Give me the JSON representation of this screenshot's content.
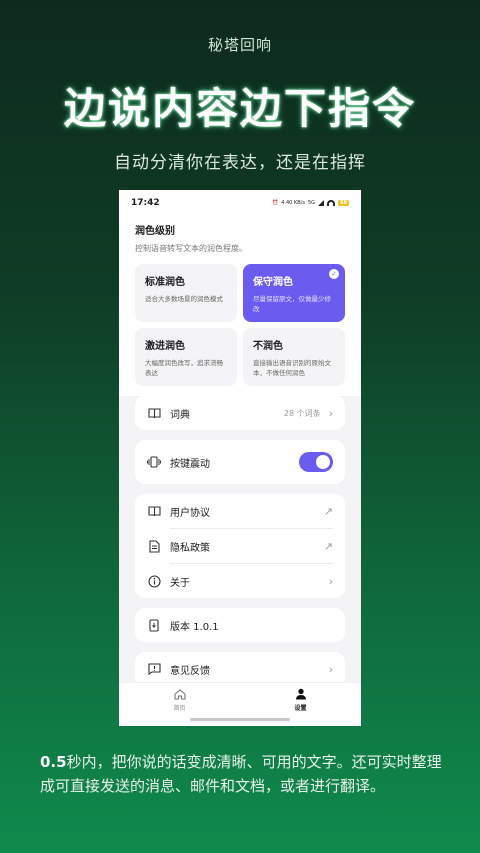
{
  "promo": {
    "brand": "秘塔回响",
    "headline": "边说内容边下指令",
    "subtitle": "自动分清你在表达，还是在指挥",
    "footer_highlight": "0.5",
    "footer_text": "秒内，把你说的话变成清晰、可用的文字。还可实时整理成可直接发送的消息、邮件和文档，或者进行翻译。"
  },
  "status": {
    "time": "17:42",
    "speed": "4.40 KB/s",
    "network": "5G",
    "battery": "69"
  },
  "polish": {
    "title": "润色级别",
    "desc": "控制语音转写文本的润色程度。",
    "options": [
      {
        "title": "标准润色",
        "desc": "适合大多数场景的润色模式"
      },
      {
        "title": "保守润色",
        "desc": "尽量保留原文，仅做最少修改"
      },
      {
        "title": "激进润色",
        "desc": "大幅度润色改写，追求流畅表达"
      },
      {
        "title": "不润色",
        "desc": "直接输出语音识别的原始文本，不做任何润色"
      }
    ]
  },
  "dictionary": {
    "label": "词典",
    "count": "28 个词条"
  },
  "vibration": {
    "label": "按键震动",
    "enabled": true
  },
  "links": [
    {
      "label": "用户协议"
    },
    {
      "label": "隐私政策"
    },
    {
      "label": "关于"
    }
  ],
  "version": {
    "label": "版本 1.0.1"
  },
  "feedback": {
    "label": "意见反馈"
  },
  "tabs": [
    {
      "label": "首页"
    },
    {
      "label": "设置"
    }
  ],
  "colors": {
    "accent": "#6b5cf0",
    "bg_green": "#0f6a3c"
  }
}
